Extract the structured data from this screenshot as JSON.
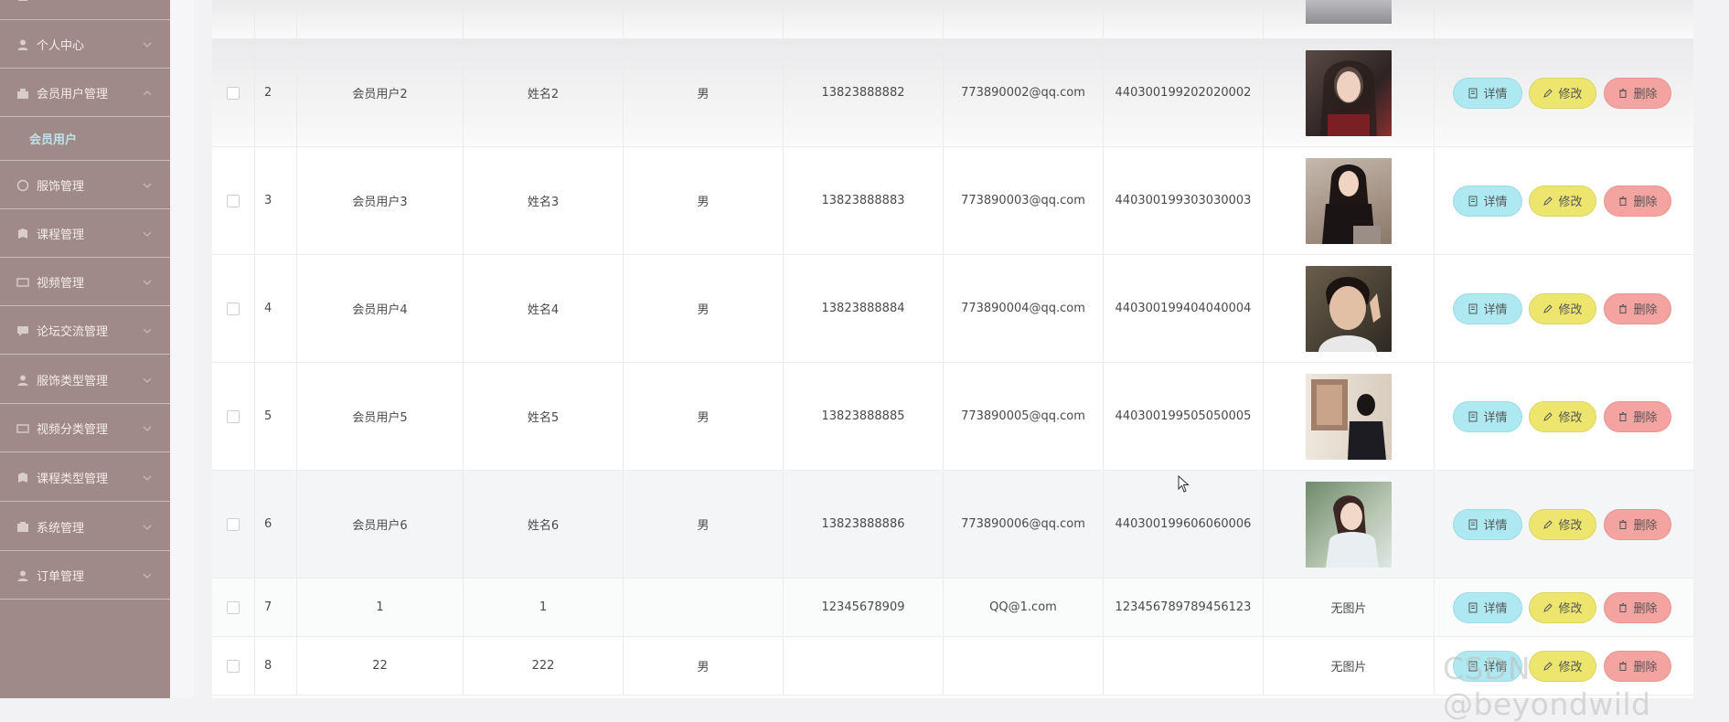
{
  "sidebar": {
    "items": [
      {
        "label": "个人中心",
        "icon": "user-icon"
      },
      {
        "label": "会员用户管理",
        "icon": "user-group-icon"
      },
      {
        "label": "服饰管理",
        "icon": "shirt-icon"
      },
      {
        "label": "课程管理",
        "icon": "book-icon"
      },
      {
        "label": "视频管理",
        "icon": "video-icon"
      },
      {
        "label": "论坛交流管理",
        "icon": "chat-icon"
      },
      {
        "label": "服饰类型管理",
        "icon": "user-icon"
      },
      {
        "label": "视频分类管理",
        "icon": "video-icon"
      },
      {
        "label": "课程类型管理",
        "icon": "book-icon"
      },
      {
        "label": "系统管理",
        "icon": "gear-icon"
      },
      {
        "label": "订单管理",
        "icon": "user-icon"
      }
    ],
    "active_sub": "会员用户"
  },
  "actions": {
    "detail": "详情",
    "edit": "修改",
    "delete": "删除"
  },
  "table": {
    "rows": [
      {
        "no": "2",
        "account": "会员用户2",
        "name": "姓名2",
        "gender": "男",
        "phone": "13823888882",
        "email": "773890002@qq.com",
        "idcard": "440300199202020002",
        "photo": "photo-2"
      },
      {
        "no": "3",
        "account": "会员用户3",
        "name": "姓名3",
        "gender": "男",
        "phone": "13823888883",
        "email": "773890003@qq.com",
        "idcard": "440300199303030003",
        "photo": "photo-3"
      },
      {
        "no": "4",
        "account": "会员用户4",
        "name": "姓名4",
        "gender": "男",
        "phone": "13823888884",
        "email": "773890004@qq.com",
        "idcard": "440300199404040004",
        "photo": "photo-4"
      },
      {
        "no": "5",
        "account": "会员用户5",
        "name": "姓名5",
        "gender": "男",
        "phone": "13823888885",
        "email": "773890005@qq.com",
        "idcard": "440300199505050005",
        "photo": "photo-5"
      },
      {
        "no": "6",
        "account": "会员用户6",
        "name": "姓名6",
        "gender": "男",
        "phone": "13823888886",
        "email": "773890006@qq.com",
        "idcard": "440300199606060006",
        "photo": "photo-6"
      },
      {
        "no": "7",
        "account": "1",
        "name": "1",
        "gender": "",
        "phone": "12345678909",
        "email": "QQ@1.com",
        "idcard": "123456789789456123",
        "photo_text": "无图片"
      },
      {
        "no": "8",
        "account": "22",
        "name": "222",
        "gender": "男",
        "phone": "",
        "email": "",
        "idcard": "",
        "photo_text": "无图片"
      }
    ]
  },
  "watermark": "CSDN @beyondwild",
  "colors": {
    "sidebar_bg": "#a08a87",
    "detail_btn": "#aee8f0",
    "edit_btn": "#ece66e",
    "delete_btn": "#f3a3a0",
    "active_sub": "#bfe3ea"
  }
}
